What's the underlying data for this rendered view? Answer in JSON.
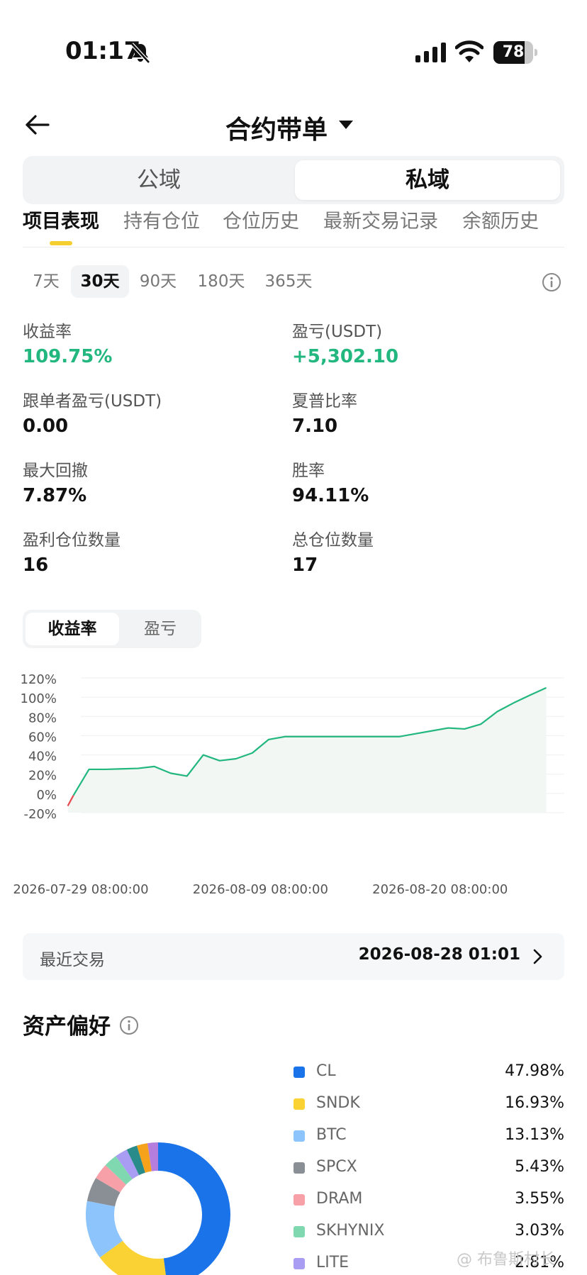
{
  "status_bar": {
    "time": "01:17",
    "battery": "78",
    "battery_level": 0.78
  },
  "header": {
    "title": "合约带单"
  },
  "segment": {
    "public": "公域",
    "private": "私域"
  },
  "tabs": [
    "项目表现",
    "持有仓位",
    "仓位历史",
    "最新交易记录",
    "余额历史"
  ],
  "periods": [
    "7天",
    "30天",
    "90天",
    "180天",
    "365天"
  ],
  "active_period": "30天",
  "metrics": {
    "roi_label": "收益率",
    "roi_value": "109.75%",
    "pnl_label": "盈亏(USDT)",
    "pnl_value": "+5,302.10",
    "follower_pnl_label": "跟单者盈亏(USDT)",
    "follower_pnl_value": "0.00",
    "sharpe_label": "夏普比率",
    "sharpe_value": "7.10",
    "mdd_label": "最大回撤",
    "mdd_value": "7.87%",
    "winrate_label": "胜率",
    "winrate_value": "94.11%",
    "win_positions_label": "盈利仓位数量",
    "win_positions_value": "16",
    "total_positions_label": "总仓位数量",
    "total_positions_value": "17"
  },
  "chart_toggle": {
    "rate": "收益率",
    "pnl": "盈亏"
  },
  "chart_data": {
    "type": "area",
    "y_ticks": [
      "120%",
      "100%",
      "80%",
      "60%",
      "40%",
      "20%",
      "0%",
      "-20%"
    ],
    "ylim": [
      -20,
      120
    ],
    "x_ticks": [
      "2026-07-29 08:00:00",
      "2026-08-09 08:00:00",
      "2026-08-20 08:00:00"
    ],
    "xlim": [
      0,
      29
    ],
    "x_tick_positions": [
      0,
      11,
      22
    ],
    "series": [
      {
        "x": [
          -0.8,
          -0.45,
          0.5,
          1.5,
          2.5,
          3.5,
          4.5,
          5.5,
          6.5,
          7.5,
          8.5,
          9.5,
          10.5,
          11.5,
          12.5,
          13.5,
          14.5,
          15.5,
          16.5,
          17.5,
          18.5,
          19.5,
          20.5,
          21.5,
          22.5,
          23.5,
          24.5,
          25.5,
          26.5,
          27.5,
          28.5
        ],
        "y": [
          -13,
          -2,
          25,
          25,
          25.5,
          26,
          28,
          21,
          18,
          40,
          34,
          36,
          42,
          56,
          59,
          59,
          59,
          59,
          59,
          59,
          59,
          59,
          62,
          65,
          68,
          67,
          72,
          85,
          94,
          102,
          109.75
        ]
      }
    ],
    "colors": {
      "line": "#21b77e",
      "negative": "#e5484d",
      "fill": "#f2f7f4",
      "grid": "#efefef"
    }
  },
  "recent_trade": {
    "label": "最近交易",
    "time": "2026-08-28 01:01"
  },
  "asset_pref": {
    "title": "资产偏好",
    "items": [
      {
        "name": "CL",
        "pct": "47.98%",
        "value": 47.98,
        "color": "#1a73e8"
      },
      {
        "name": "SNDK",
        "pct": "16.93%",
        "value": 16.93,
        "color": "#fbd234"
      },
      {
        "name": "BTC",
        "pct": "13.13%",
        "value": 13.13,
        "color": "#8cc4fb"
      },
      {
        "name": "SPCX",
        "pct": "5.43%",
        "value": 5.43,
        "color": "#8a8f96"
      },
      {
        "name": "DRAM",
        "pct": "3.55%",
        "value": 3.55,
        "color": "#f8a0a8"
      },
      {
        "name": "SKHYNIX",
        "pct": "3.03%",
        "value": 3.03,
        "color": "#7fd8b0"
      },
      {
        "name": "LITE",
        "pct": "2.81%",
        "value": 2.81,
        "color": "#a99cf3"
      }
    ],
    "other_colors": [
      "#2a8c8a",
      "#f7a21b",
      "#b57edc"
    ],
    "other_values": [
      2.4,
      2.4,
      2.34
    ]
  },
  "watermark": "@ 布鲁斯村长"
}
